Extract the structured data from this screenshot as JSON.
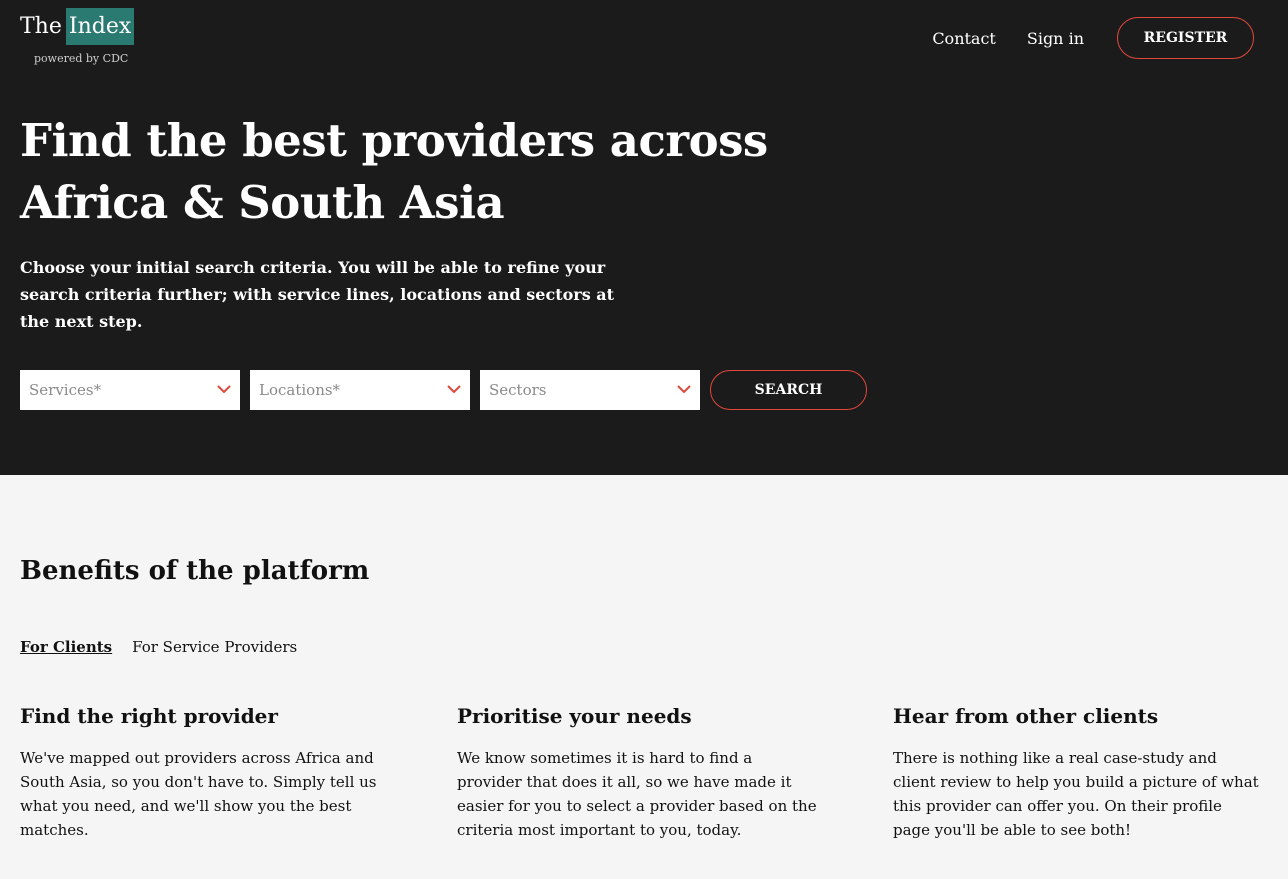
{
  "brand": {
    "logo_the": "The",
    "logo_index": "Index",
    "logo_sub": "powered by CDC",
    "logo_color": "#2a7a72"
  },
  "nav": {
    "contact": "Contact",
    "signin": "Sign in",
    "register": "REGISTER"
  },
  "hero": {
    "title_line1": "Find the best providers across",
    "title_line2": "Africa & South Asia",
    "subtitle": "Choose your initial search criteria. You will be able to refine your search criteria further; with service lines, locations and sectors at the next step.",
    "bg_color": "#1b1b1b",
    "accent_color": "#e0483b"
  },
  "search": {
    "services_placeholder": "Services*",
    "locations_placeholder": "Locations*",
    "sectors_placeholder": "Sectors",
    "search_label": "SEARCH"
  },
  "benefits": {
    "title": "Benefits of the platform",
    "tabs": [
      {
        "label": "For Clients",
        "active": true
      },
      {
        "label": "For Service Providers",
        "active": false
      }
    ],
    "columns": [
      {
        "heading": "Find the right provider",
        "text": "We've mapped out providers across Africa and South Asia, so you don't have to. Simply tell us what you need, and we'll show you the best matches."
      },
      {
        "heading": "Prioritise your needs",
        "text": "We know sometimes it is hard to find a provider that does it all, so we have made it easier for you to select a provider based on the criteria most important to you, today."
      },
      {
        "heading": "Hear from other clients",
        "text": "There is nothing like a real case-study and client review to help you build a picture of what this provider can offer you. On their profile page you'll be able to see both!"
      }
    ]
  }
}
